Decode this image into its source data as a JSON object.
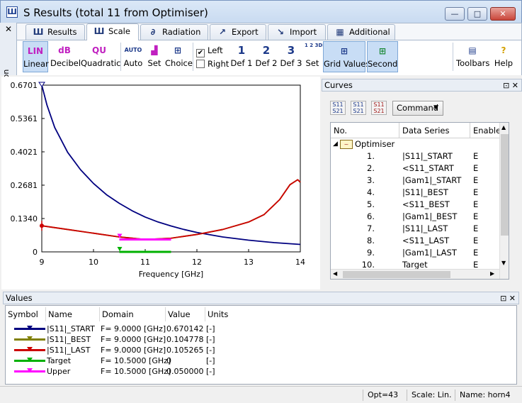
{
  "window": {
    "title": "S Results (total 11 from Optimiser)",
    "minimize_glyph": "—",
    "maximize_glyph": "□",
    "close_glyph": "✕"
  },
  "ribbon": {
    "side_close": "✕",
    "side_label": "Ribbon",
    "tabs": [
      {
        "label": "Results",
        "icon": "results-icon"
      },
      {
        "label": "Scale",
        "icon": "scale-icon"
      },
      {
        "label": "Radiation",
        "icon": "radiation-icon"
      },
      {
        "label": "Export",
        "icon": "export-icon"
      },
      {
        "label": "Import",
        "icon": "import-icon"
      },
      {
        "label": "Additional",
        "icon": "additional-icon"
      }
    ],
    "active_tab": "Scale",
    "buttons": {
      "linear": "Linear",
      "decibel": "Decibel",
      "quadratic": "Quadratic",
      "auto": "Auto",
      "set": "Set",
      "choice": "Choice",
      "left": "Left",
      "right": "Right",
      "def1": "Def 1",
      "def2": "Def 2",
      "def3": "Def 3",
      "set2": "Set",
      "grid_values": "Grid Values",
      "second": "Second",
      "toolbars": "Toolbars",
      "help": "Help"
    },
    "icon_text": {
      "lin": "LIN",
      "db": "dB",
      "qu": "QU",
      "auto": "AUTO",
      "def1": "1",
      "def2": "2",
      "def3": "3",
      "def_set": "1 2 3DEF"
    },
    "left_checked": true,
    "right_checked": false
  },
  "chart_data": {
    "type": "line",
    "xlabel": "Frequency [GHz]",
    "xlim": [
      9,
      14
    ],
    "ylim": [
      0,
      0.6701
    ],
    "x_ticks": [
      "9",
      "10",
      "11",
      "12",
      "13",
      "14"
    ],
    "y_ticks": [
      "0",
      "0.1340",
      "0.2681",
      "0.4021",
      "0.5361",
      "0.6701"
    ],
    "y_tick_values": [
      0,
      0.134,
      0.2681,
      0.4021,
      0.5361,
      0.6701
    ],
    "series": [
      {
        "name": "|S11|_START",
        "color": "#000080",
        "x": [
          9.0,
          9.1,
          9.25,
          9.5,
          9.75,
          10.0,
          10.25,
          10.5,
          10.75,
          11.0,
          11.25,
          11.5,
          11.75,
          12.0,
          12.5,
          13.0,
          13.5,
          14.0
        ],
        "y": [
          0.6701,
          0.59,
          0.5,
          0.4,
          0.33,
          0.275,
          0.23,
          0.195,
          0.165,
          0.14,
          0.12,
          0.104,
          0.09,
          0.078,
          0.06,
          0.047,
          0.037,
          0.03
        ]
      },
      {
        "name": "|S11|_BEST",
        "color": "#808000",
        "x": [
          9.0,
          9.5,
          10.0,
          10.5,
          11.0,
          11.5,
          12.0,
          12.5,
          13.0,
          13.3,
          13.6,
          13.8,
          13.95,
          14.0
        ],
        "y": [
          0.105,
          0.09,
          0.075,
          0.06,
          0.05,
          0.055,
          0.07,
          0.09,
          0.12,
          0.15,
          0.21,
          0.27,
          0.29,
          0.28
        ]
      },
      {
        "name": "|S11|_LAST",
        "color": "#cc0000",
        "x": [
          9.0,
          9.5,
          10.0,
          10.5,
          11.0,
          11.5,
          12.0,
          12.5,
          13.0,
          13.3,
          13.6,
          13.8,
          13.95,
          14.0
        ],
        "y": [
          0.105,
          0.09,
          0.075,
          0.06,
          0.05,
          0.055,
          0.07,
          0.09,
          0.12,
          0.15,
          0.21,
          0.27,
          0.29,
          0.28
        ]
      },
      {
        "name": "Target",
        "color": "#00b000",
        "x": [
          10.5,
          11.5
        ],
        "y": [
          0.0,
          0.0
        ]
      },
      {
        "name": "Upper",
        "color": "#ff00ff",
        "x": [
          10.5,
          11.5
        ],
        "y": [
          0.05,
          0.05
        ]
      }
    ]
  },
  "curves_panel": {
    "title": "Curves",
    "pin_glyph": "⊡",
    "close_glyph": "✕",
    "toolbar_icons": [
      "s11-s21-icon",
      "s11-s21-icon",
      "s11-s21-icon"
    ],
    "toolbar_icon_text": [
      "S11 S21",
      "S11 S21",
      "S11 S21"
    ],
    "command_label": "Command",
    "columns": [
      "No.",
      "Data Series",
      "Enabled"
    ],
    "group": "Optimiser",
    "rows": [
      {
        "no": "1.",
        "series": "|S11|_START",
        "enabled": "E"
      },
      {
        "no": "2.",
        "series": "<S11_START",
        "enabled": "E"
      },
      {
        "no": "3.",
        "series": "|Gam1|_START",
        "enabled": "E"
      },
      {
        "no": "4.",
        "series": "|S11|_BEST",
        "enabled": "E"
      },
      {
        "no": "5.",
        "series": "<S11_BEST",
        "enabled": "E"
      },
      {
        "no": "6.",
        "series": "|Gam1|_BEST",
        "enabled": "E"
      },
      {
        "no": "7.",
        "series": "|S11|_LAST",
        "enabled": "E"
      },
      {
        "no": "8.",
        "series": "<S11_LAST",
        "enabled": "E"
      },
      {
        "no": "9.",
        "series": "|Gam1|_LAST",
        "enabled": "E"
      },
      {
        "no": "10.",
        "series": "Target",
        "enabled": "E"
      }
    ]
  },
  "values_panel": {
    "title": "Values",
    "pin_glyph": "⊡",
    "close_glyph": "✕",
    "columns": [
      "Symbol",
      "Name",
      "Domain",
      "Value",
      "Units"
    ],
    "rows": [
      {
        "name": "|S11|_START",
        "domain": "F=  9.0000 [GHz]",
        "value": "0.670142",
        "units": "[-]",
        "color": "#000080"
      },
      {
        "name": "|S11|_BEST",
        "domain": "F=  9.0000 [GHz]",
        "value": "0.104778",
        "units": "[-]",
        "color": "#808000"
      },
      {
        "name": "|S11|_LAST",
        "domain": "F=  9.0000 [GHz]",
        "value": "0.105265",
        "units": "[-]",
        "color": "#cc0000"
      },
      {
        "name": "Target",
        "domain": "F= 10.5000 [GHz]",
        "value": "0",
        "units": "[-]",
        "color": "#00b000"
      },
      {
        "name": "Upper",
        "domain": "F= 10.5000 [GHz]",
        "value": "0.050000",
        "units": "[-]",
        "color": "#ff00ff"
      }
    ]
  },
  "status_bar": {
    "opt": "Opt=43",
    "scale": "Scale: Lin.",
    "name": "Name: horn4"
  }
}
